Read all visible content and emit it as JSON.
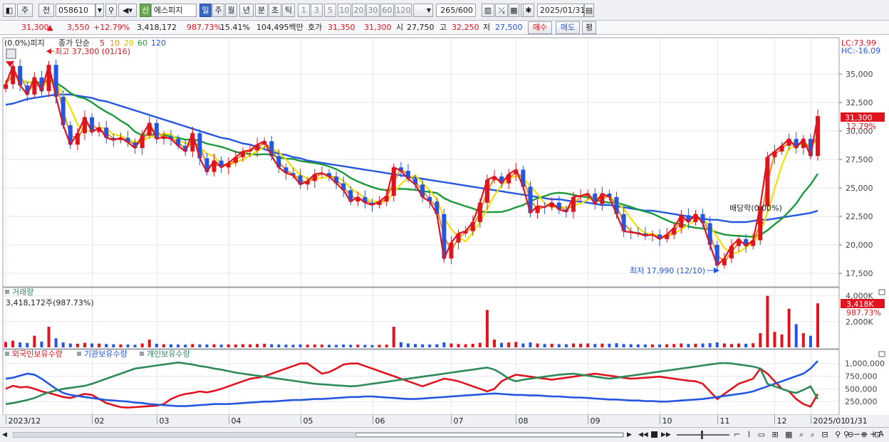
{
  "toolbar": {
    "period_day": "주",
    "prev_label": "전",
    "code": "058610",
    "badge": "신",
    "stock_name": "에스피지",
    "periods": [
      "일",
      "주",
      "월",
      "년",
      "분",
      "초",
      "틱"
    ],
    "multipliers": [
      "1",
      "3",
      "5",
      "10",
      "20",
      "30",
      "60",
      "120"
    ],
    "bar_count": "265",
    "bar_total": "/600",
    "date": "2025/01/31"
  },
  "quote": {
    "price": "31,300",
    "arrow": "▲",
    "change": "3,550",
    "change_pct": "+12.79%",
    "volume": "3,418,172",
    "volume_pct": "987.73%",
    "turnover": "15.41%",
    "amount": "104,495백만",
    "ask_label": "호가",
    "ask1": "31,350",
    "ask2": "31,300",
    "open_label": "시",
    "open": "27,750",
    "high_label": "고",
    "high": "32,250",
    "low_label": "저",
    "low": "27,500",
    "buy_button": "매수",
    "sell_button": "매도",
    "eval_button": "평"
  },
  "chart_data": [
    {
      "type": "candlestick",
      "title_overlay": "(0.0%)피지",
      "legend": {
        "label": "종가 단순",
        "periods": [
          "5",
          "10",
          "20",
          "60",
          "120"
        ],
        "colors": [
          "#e0141e",
          "#f08c1e",
          "#f0e000",
          "#1a9a3a",
          "#2456e0"
        ]
      },
      "y_ticks": [
        "35,000",
        "32,500",
        "30,000",
        "27,500",
        "25,000",
        "22,500",
        "20,000",
        "17,500"
      ],
      "ylim": [
        16500,
        38000
      ],
      "right_labels": {
        "lc": "LC:73.99",
        "hc": "HC:-16.09",
        "last_price": "31,300",
        "last_pct": "12.79%"
      },
      "annotations": {
        "high": "최고 37,300 (01/16)",
        "low": "최저 17,990 (12/10)",
        "dividend": "배당락(0.00%)"
      },
      "series": {
        "close": [
          34100,
          35700,
          34000,
          33200,
          34700,
          33500,
          35800,
          33000,
          30500,
          28800,
          29800,
          31200,
          29900,
          30300,
          29400,
          29200,
          29400,
          29000,
          28500,
          29600,
          30700,
          29300,
          29500,
          29300,
          28700,
          28200,
          29800,
          27600,
          26400,
          27400,
          26800,
          27200,
          27700,
          28200,
          28300,
          28800,
          29100,
          27800,
          26800,
          26300,
          26100,
          25300,
          25600,
          26200,
          26300,
          26000,
          25400,
          24800,
          23800,
          24200,
          23700,
          23500,
          23800,
          24300,
          26800,
          26500,
          25800,
          25300,
          24200,
          23800,
          22700,
          18800,
          20200,
          21000,
          21200,
          22000,
          23700,
          25700,
          26000,
          25400,
          26200,
          26600,
          25100,
          22800,
          23400,
          23300,
          23700,
          23100,
          22900,
          24200,
          24300,
          24500,
          23600,
          24500,
          24200,
          22700,
          21200,
          21100,
          21000,
          20800,
          20900,
          20500,
          20900,
          21500,
          22600,
          22000,
          22700,
          21900,
          20000,
          18200,
          18800,
          19900,
          20500,
          19900,
          20400,
          23400,
          27700,
          28200,
          28700,
          29300,
          28500,
          29300,
          27800,
          31300
        ],
        "ma120": [
          32300,
          32400,
          32600,
          32800,
          32900,
          33000,
          33100,
          33200,
          33200,
          33200,
          33100,
          33000,
          32900,
          32700,
          32600,
          32400,
          32200,
          32000,
          31800,
          31600,
          31400,
          31200,
          31000,
          30800,
          30600,
          30400,
          30200,
          30000,
          29800,
          29600,
          29400,
          29300,
          29100,
          28900,
          28800,
          28600,
          28400,
          28200,
          28000,
          27900,
          27700,
          27600,
          27400,
          27300,
          27200,
          27100,
          27000,
          26900,
          26800,
          26700,
          26600,
          26500,
          26400,
          26300,
          26200,
          26100,
          26000,
          25900,
          25800,
          25700,
          25600,
          25500,
          25400,
          25300,
          25200,
          25100,
          25000,
          24900,
          24800,
          24700,
          24600,
          24500,
          24400,
          24300,
          24200,
          24100,
          24000,
          24000,
          23900,
          23800,
          23800,
          23700,
          23600,
          23500,
          23500,
          23400,
          23300,
          23200,
          23100,
          23000,
          23000,
          22900,
          22800,
          22700,
          22600,
          22500,
          22400,
          22300,
          22200,
          22200,
          22100,
          22000,
          22000,
          22000,
          22100,
          22200,
          22200,
          22300,
          22400,
          22500,
          22600,
          22700,
          22800,
          23000
        ]
      }
    },
    {
      "type": "bar",
      "title": "거래량",
      "summary": "3,418,172주(987.73%)",
      "y_ticks": [
        "4,000K",
        "2,000K"
      ],
      "ylim": [
        0,
        4200
      ],
      "right_labels": {
        "last": "3,418K",
        "last_pct": "987.73%"
      },
      "values_k": [
        420,
        520,
        380,
        340,
        900,
        450,
        1600,
        700,
        380,
        300,
        280,
        350,
        300,
        290,
        260,
        240,
        230,
        220,
        200,
        300,
        600,
        280,
        240,
        230,
        220,
        210,
        260,
        230,
        220,
        240,
        210,
        230,
        220,
        250,
        230,
        260,
        280,
        240,
        220,
        210,
        200,
        230,
        210,
        220,
        210,
        200,
        190,
        220,
        200,
        210,
        190,
        180,
        200,
        210,
        1600,
        400,
        300,
        260,
        230,
        220,
        240,
        380,
        300,
        260,
        240,
        280,
        350,
        2900,
        600,
        350,
        380,
        420,
        300,
        380,
        300,
        260,
        280,
        250,
        240,
        300,
        280,
        300,
        260,
        290,
        280,
        320,
        260,
        240,
        230,
        220,
        230,
        220,
        240,
        260,
        300,
        260,
        280,
        300,
        320,
        380,
        300,
        260,
        300,
        280,
        320,
        1100,
        4000,
        1200,
        1000,
        3000,
        1800,
        1100,
        900,
        3418
      ]
    },
    {
      "type": "line",
      "legend": [
        "외국인보유수량",
        "기관보유수량",
        "개인보유수량"
      ],
      "legend_colors": [
        "#e0141e",
        "#2456e0",
        "#2e8a5a"
      ],
      "y_ticks": [
        "1,000,000",
        "750,000",
        "500,000",
        "250,000"
      ],
      "ylim": [
        0,
        1150000
      ],
      "x_labels": [
        "2023/12",
        "02",
        "03",
        "04",
        "05",
        "06",
        "07",
        "08",
        "09",
        "10",
        "11",
        "12",
        "2025/01",
        "01/31"
      ],
      "series": [
        {
          "name": "외국인보유수량",
          "values": [
            500000,
            560000,
            530000,
            540000,
            500000,
            450000,
            420000,
            380000,
            340000,
            320000,
            360000,
            400000,
            380000,
            300000,
            220000,
            180000,
            140000,
            130000,
            140000,
            150000,
            160000,
            170000,
            200000,
            300000,
            360000,
            400000,
            420000,
            450000,
            430000,
            460000,
            500000,
            550000,
            600000,
            650000,
            700000,
            720000,
            750000,
            800000,
            850000,
            900000,
            950000,
            1000000,
            1000000,
            900000,
            800000,
            830000,
            900000,
            980000,
            1000000,
            1000000,
            950000,
            900000,
            850000,
            800000,
            750000,
            700000,
            650000,
            600000,
            550000,
            600000,
            650000,
            700000,
            680000,
            650000,
            600000,
            550000,
            500000,
            450000,
            500000,
            650000,
            720000,
            780000,
            760000,
            740000,
            720000,
            700000,
            680000,
            700000,
            720000,
            740000,
            760000,
            780000,
            800000,
            780000,
            760000,
            740000,
            720000,
            700000,
            710000,
            720000,
            730000,
            740000,
            720000,
            700000,
            680000,
            660000,
            650000,
            600000,
            450000,
            300000,
            400000,
            500000,
            600000,
            650000,
            700000,
            900000,
            800000,
            650000,
            500000,
            450000,
            300000,
            200000,
            150000,
            400000
          ]
        },
        {
          "name": "기관보유수량",
          "values": [
            700000,
            720000,
            760000,
            800000,
            780000,
            700000,
            600000,
            500000,
            420000,
            380000,
            360000,
            340000,
            320000,
            300000,
            280000,
            270000,
            260000,
            250000,
            230000,
            220000,
            200000,
            190000,
            180000,
            170000,
            160000,
            160000,
            170000,
            180000,
            190000,
            200000,
            200000,
            200000,
            210000,
            220000,
            230000,
            240000,
            250000,
            250000,
            260000,
            270000,
            280000,
            280000,
            290000,
            300000,
            300000,
            310000,
            320000,
            330000,
            340000,
            340000,
            350000,
            350000,
            340000,
            330000,
            320000,
            310000,
            300000,
            300000,
            310000,
            320000,
            330000,
            340000,
            350000,
            360000,
            370000,
            380000,
            390000,
            400000,
            410000,
            400000,
            390000,
            380000,
            380000,
            370000,
            370000,
            360000,
            350000,
            350000,
            340000,
            330000,
            330000,
            320000,
            310000,
            300000,
            290000,
            290000,
            280000,
            270000,
            270000,
            260000,
            260000,
            250000,
            250000,
            260000,
            270000,
            280000,
            290000,
            300000,
            320000,
            340000,
            360000,
            380000,
            400000,
            420000,
            450000,
            500000,
            550000,
            600000,
            650000,
            700000,
            750000,
            800000,
            900000,
            1050000
          ]
        },
        {
          "name": "개인보유수량",
          "values": [
            200000,
            220000,
            250000,
            280000,
            320000,
            380000,
            430000,
            470000,
            500000,
            520000,
            540000,
            560000,
            600000,
            650000,
            700000,
            750000,
            800000,
            850000,
            900000,
            920000,
            940000,
            960000,
            980000,
            1000000,
            1020000,
            1000000,
            980000,
            950000,
            930000,
            900000,
            880000,
            850000,
            820000,
            800000,
            780000,
            760000,
            740000,
            720000,
            700000,
            680000,
            660000,
            640000,
            620000,
            600000,
            590000,
            580000,
            570000,
            560000,
            550000,
            560000,
            580000,
            600000,
            620000,
            640000,
            660000,
            680000,
            700000,
            720000,
            740000,
            760000,
            780000,
            800000,
            820000,
            840000,
            860000,
            880000,
            900000,
            920000,
            880000,
            800000,
            700000,
            650000,
            680000,
            700000,
            720000,
            740000,
            760000,
            780000,
            790000,
            800000,
            780000,
            760000,
            740000,
            720000,
            700000,
            720000,
            740000,
            760000,
            780000,
            800000,
            820000,
            840000,
            860000,
            880000,
            900000,
            920000,
            940000,
            960000,
            980000,
            1000000,
            1010000,
            1000000,
            980000,
            960000,
            940000,
            900000,
            600000,
            550000,
            500000,
            450000,
            420000,
            480000,
            550000,
            300000
          ]
        }
      ]
    }
  ]
}
